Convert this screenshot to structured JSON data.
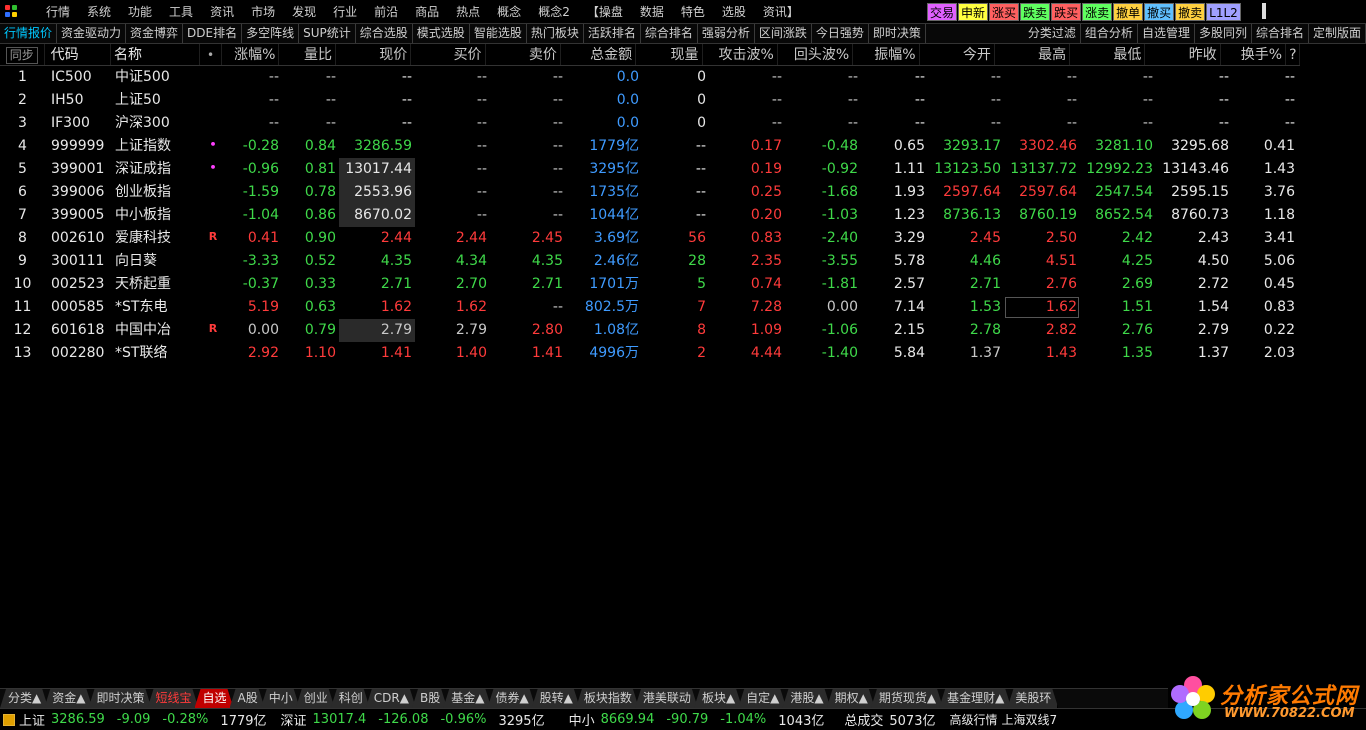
{
  "menubar": {
    "items": [
      "行情",
      "系统",
      "功能",
      "工具",
      "资讯",
      "市场",
      "发现",
      "行业",
      "前沿",
      "商品",
      "热点",
      "概念",
      "概念2",
      "【操盘",
      "数据",
      "特色",
      "选股",
      "资讯】"
    ],
    "quick_buttons": [
      {
        "label": "交易",
        "color": "#e060ff"
      },
      {
        "label": "申新",
        "color": "#ffff40"
      },
      {
        "label": "涨买",
        "color": "#ff6060"
      },
      {
        "label": "跌卖",
        "color": "#60ff60"
      },
      {
        "label": "跌买",
        "color": "#ff6060"
      },
      {
        "label": "涨卖",
        "color": "#60ff60"
      },
      {
        "label": "撤单",
        "color": "#ffd040"
      },
      {
        "label": "撤买",
        "color": "#60c0ff"
      },
      {
        "label": "撤卖",
        "color": "#ffd040"
      },
      {
        "label": "L1L2",
        "color": "#a0a0ff"
      }
    ]
  },
  "tabs": {
    "left": [
      "行情报价",
      "资金驱动力",
      "资金博弈",
      "DDE排名",
      "多空阵线",
      "SUP统计",
      "综合选股",
      "模式选股",
      "智能选股",
      "热门板块",
      "活跃排名",
      "综合排名",
      "强弱分析",
      "区间涨跌",
      "今日强势",
      "即时决策"
    ],
    "right": [
      "分类过滤",
      "组合分析",
      "自选管理",
      "多股同列",
      "综合排名",
      "定制版面"
    ],
    "active": "行情报价"
  },
  "grid": {
    "sync_button": "同步",
    "columns": [
      "代码",
      "名称",
      "•",
      "涨幅%",
      "量比",
      "现价",
      "买价",
      "卖价",
      "总金额",
      "现量",
      "攻击波%",
      "回头波%",
      "振幅%",
      "今开",
      "最高",
      "最低",
      "昨收",
      "换手%"
    ],
    "help": "?",
    "rows": [
      {
        "idx": "1",
        "code": "IC500",
        "name": "中证500",
        "mark": "",
        "zf": "--",
        "lb": "--",
        "xj": "--",
        "mr": "--",
        "mc": "--",
        "ze": "0.0",
        "xl": "0",
        "gj": "--",
        "ht": "--",
        "zfd": "--",
        "jk": "--",
        "zg": "--",
        "zd": "--",
        "zs": "--",
        "hs": "--"
      },
      {
        "idx": "2",
        "code": "IH50",
        "name": "上证50",
        "mark": "",
        "zf": "--",
        "lb": "--",
        "xj": "--",
        "mr": "--",
        "mc": "--",
        "ze": "0.0",
        "xl": "0",
        "gj": "--",
        "ht": "--",
        "zfd": "--",
        "jk": "--",
        "zg": "--",
        "zd": "--",
        "zs": "--",
        "hs": "--"
      },
      {
        "idx": "3",
        "code": "IF300",
        "name": "沪深300",
        "mark": "",
        "zf": "--",
        "lb": "--",
        "xj": "--",
        "mr": "--",
        "mc": "--",
        "ze": "0.0",
        "xl": "0",
        "gj": "--",
        "ht": "--",
        "zfd": "--",
        "jk": "--",
        "zg": "--",
        "zd": "--",
        "zs": "--",
        "hs": "--"
      },
      {
        "idx": "4",
        "code": "999999",
        "name": "上证指数",
        "mark": "•",
        "zf": "-0.28",
        "lb": "0.84",
        "xj": "3286.59",
        "mr": "--",
        "mc": "--",
        "ze": "1779亿",
        "xl": "--",
        "gj": "0.17",
        "ht": "-0.48",
        "zfd": "0.65",
        "jk": "3293.17",
        "zg": "3302.46",
        "zd": "3281.10",
        "zs": "3295.68",
        "hs": "0.41"
      },
      {
        "idx": "5",
        "code": "399001",
        "name": "深证成指",
        "mark": "•",
        "zf": "-0.96",
        "lb": "0.81",
        "xj": "13017.44",
        "mr": "--",
        "mc": "--",
        "ze": "3295亿",
        "xl": "--",
        "gj": "0.19",
        "ht": "-0.92",
        "zfd": "1.11",
        "jk": "13123.50",
        "zg": "13137.72",
        "zd": "12992.23",
        "zs": "13143.46",
        "hs": "1.43"
      },
      {
        "idx": "6",
        "code": "399006",
        "name": "创业板指",
        "mark": "",
        "zf": "-1.59",
        "lb": "0.78",
        "xj": "2553.96",
        "mr": "--",
        "mc": "--",
        "ze": "1735亿",
        "xl": "--",
        "gj": "0.25",
        "ht": "-1.68",
        "zfd": "1.93",
        "jk": "2597.64",
        "zg": "2597.64",
        "zd": "2547.54",
        "zs": "2595.15",
        "hs": "3.76"
      },
      {
        "idx": "7",
        "code": "399005",
        "name": "中小板指",
        "mark": "",
        "zf": "-1.04",
        "lb": "0.86",
        "xj": "8670.02",
        "mr": "--",
        "mc": "--",
        "ze": "1044亿",
        "xl": "--",
        "gj": "0.20",
        "ht": "-1.03",
        "zfd": "1.23",
        "jk": "8736.13",
        "zg": "8760.19",
        "zd": "8652.54",
        "zs": "8760.73",
        "hs": "1.18"
      },
      {
        "idx": "8",
        "code": "002610",
        "name": "爱康科技",
        "mark": "R",
        "zf": "0.41",
        "lb": "0.90",
        "xj": "2.44",
        "mr": "2.44",
        "mc": "2.45",
        "ze": "3.69亿",
        "xl": "56",
        "gj": "0.83",
        "ht": "-2.40",
        "zfd": "3.29",
        "jk": "2.45",
        "zg": "2.50",
        "zd": "2.42",
        "zs": "2.43",
        "hs": "3.41"
      },
      {
        "idx": "9",
        "code": "300111",
        "name": "向日葵",
        "mark": "",
        "zf": "-3.33",
        "lb": "0.52",
        "xj": "4.35",
        "mr": "4.34",
        "mc": "4.35",
        "ze": "2.46亿",
        "xl": "28",
        "gj": "2.35",
        "ht": "-3.55",
        "zfd": "5.78",
        "jk": "4.46",
        "zg": "4.51",
        "zd": "4.25",
        "zs": "4.50",
        "hs": "5.06"
      },
      {
        "idx": "10",
        "code": "002523",
        "name": "天桥起重",
        "mark": "",
        "zf": "-0.37",
        "lb": "0.33",
        "xj": "2.71",
        "mr": "2.70",
        "mc": "2.71",
        "ze": "1701万",
        "xl": "5",
        "gj": "0.74",
        "ht": "-1.81",
        "zfd": "2.57",
        "jk": "2.71",
        "zg": "2.76",
        "zd": "2.69",
        "zs": "2.72",
        "hs": "0.45"
      },
      {
        "idx": "11",
        "code": "000585",
        "name": "*ST东电",
        "mark": "",
        "zf": "5.19",
        "lb": "0.63",
        "xj": "1.62",
        "mr": "1.62",
        "mc": "--",
        "ze": "802.5万",
        "xl": "7",
        "gj": "7.28",
        "ht": "0.00",
        "zfd": "7.14",
        "jk": "1.53",
        "zg": "1.62",
        "zd": "1.51",
        "zs": "1.54",
        "hs": "0.83"
      },
      {
        "idx": "12",
        "code": "601618",
        "name": "中国中冶",
        "mark": "R",
        "zf": "0.00",
        "lb": "0.79",
        "xj": "2.79",
        "mr": "2.79",
        "mc": "2.80",
        "ze": "1.08亿",
        "xl": "8",
        "gj": "1.09",
        "ht": "-1.06",
        "zfd": "2.15",
        "jk": "2.78",
        "zg": "2.82",
        "zd": "2.76",
        "zs": "2.79",
        "hs": "0.22"
      },
      {
        "idx": "13",
        "code": "002280",
        "name": "*ST联络",
        "mark": "",
        "zf": "2.92",
        "lb": "1.10",
        "xj": "1.41",
        "mr": "1.40",
        "mc": "1.41",
        "ze": "4996万",
        "xl": "2",
        "gj": "4.44",
        "ht": "-1.40",
        "zfd": "5.84",
        "jk": "1.37",
        "zg": "1.43",
        "zd": "1.35",
        "zs": "1.37",
        "hs": "2.03"
      }
    ]
  },
  "bottom_tabs": [
    "分类▲",
    "资金▲",
    "即时决策",
    "短线宝",
    "自选",
    "A股",
    "中小",
    "创业",
    "科创",
    "CDR▲",
    "B股",
    "基金▲",
    "债券▲",
    "股转▲",
    "板块指数",
    "港美联动",
    "板块▲",
    "自定▲",
    "港股▲",
    "期权▲",
    "期货现货▲",
    "基金理财▲",
    "美股环"
  ],
  "statusbar": {
    "sh_label": "上证",
    "sh_price": "3286.59",
    "sh_chg": "-9.09",
    "sh_pct": "-0.28%",
    "sh_amt": "1779亿",
    "sz_label": "深证",
    "sz_price": "13017.4",
    "sz_chg": "-126.08",
    "sz_pct": "-0.96%",
    "sz_amt": "3295亿",
    "zx_label": "中小",
    "zx_price": "8669.94",
    "zx_chg": "-90.79",
    "zx_pct": "-1.04%",
    "zx_amt": "1043亿",
    "total_label": "总成交",
    "total_amt": "5073亿",
    "mode": "高级行情",
    "server": "上海双线7"
  },
  "watermark": {
    "title": "分析家公式网",
    "url": "WWW.70822.COM"
  },
  "colors": {
    "up": "#ff3b3b",
    "down": "#3fd94a",
    "blue": "#3f9bff",
    "active_tab": "#00c8ff",
    "selected_bottom_tab": "#c00000"
  }
}
